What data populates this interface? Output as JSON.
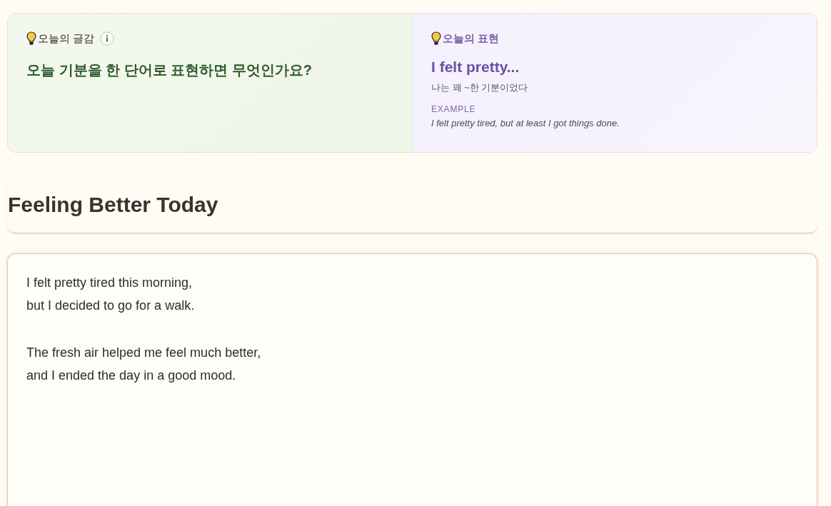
{
  "prompt_card": {
    "label": "오늘의 글감",
    "question": "오늘 기분을 한 단어로 표현하면 무엇인가요?"
  },
  "expression_card": {
    "label": "오늘의 표현",
    "phrase": "I felt pretty...",
    "meaning": "나는 꽤 ~한 기분이었다",
    "example_label": "EXAMPLE",
    "example": "I felt pretty tired, but at least I got things done."
  },
  "entry": {
    "title": "Feeling Better Today",
    "body": [
      [
        "I felt pretty tired this morning,",
        "but I decided to go for a walk."
      ],
      [
        "The fresh air helped me feel much better,",
        "and I ended the day in a good mood."
      ]
    ]
  }
}
